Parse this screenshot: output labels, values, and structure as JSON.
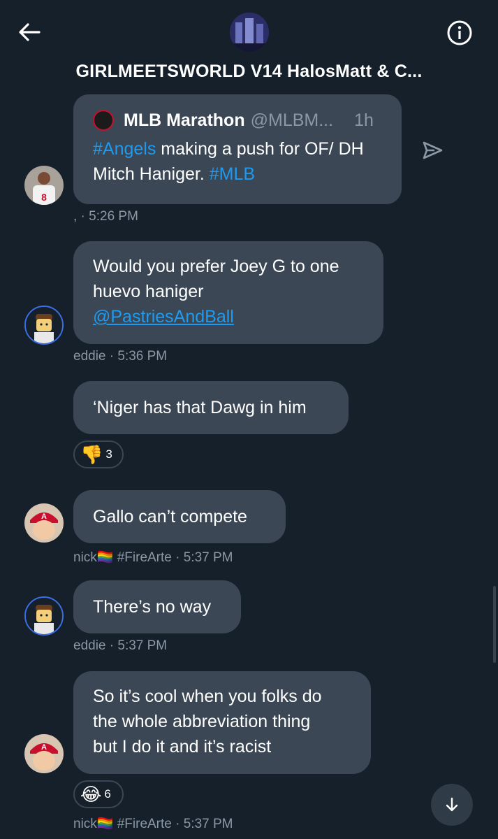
{
  "header": {
    "title": "GIRLMEETSWORLD V14 HalosMatt & C...",
    "back_icon": "arrow-left-icon",
    "info_icon": "info-icon"
  },
  "quote": {
    "name": "MLB Marathon",
    "handle": "@MLBM...",
    "time": "1h",
    "text_parts": [
      "#Angels",
      " making a push for OF/ DH Mitch Haniger. ",
      "#MLB"
    ],
    "meta": ", · 5:26 PM"
  },
  "messages": [
    {
      "line1": "Would you prefer Joey G to one",
      "line2": "huevo haniger",
      "mention": "@PastriesAndBall",
      "meta": "eddie · 5:36 PM"
    },
    {
      "text": "‘Niger has that Dawg in him",
      "reaction_emoji": "👎",
      "reaction_count": "3"
    },
    {
      "text": "Gallo can’t compete",
      "meta": "nick🏳️‍🌈 #FireArte · 5:37 PM"
    },
    {
      "text": "There’s no way",
      "meta": "eddie · 5:37 PM"
    },
    {
      "line1": "So it’s cool when you folks do",
      "line2": "the whole abbreviation thing",
      "line3": "but I do it and it’s racist",
      "reaction_emoji": "😂",
      "reaction_count": "6",
      "meta": "nick🏳️‍🌈 #FireArte · 5:37 PM"
    }
  ],
  "colors": {
    "background": "#15202b",
    "bubble": "#3b4754",
    "link": "#1d9bf0",
    "muted": "#8b98a5"
  }
}
